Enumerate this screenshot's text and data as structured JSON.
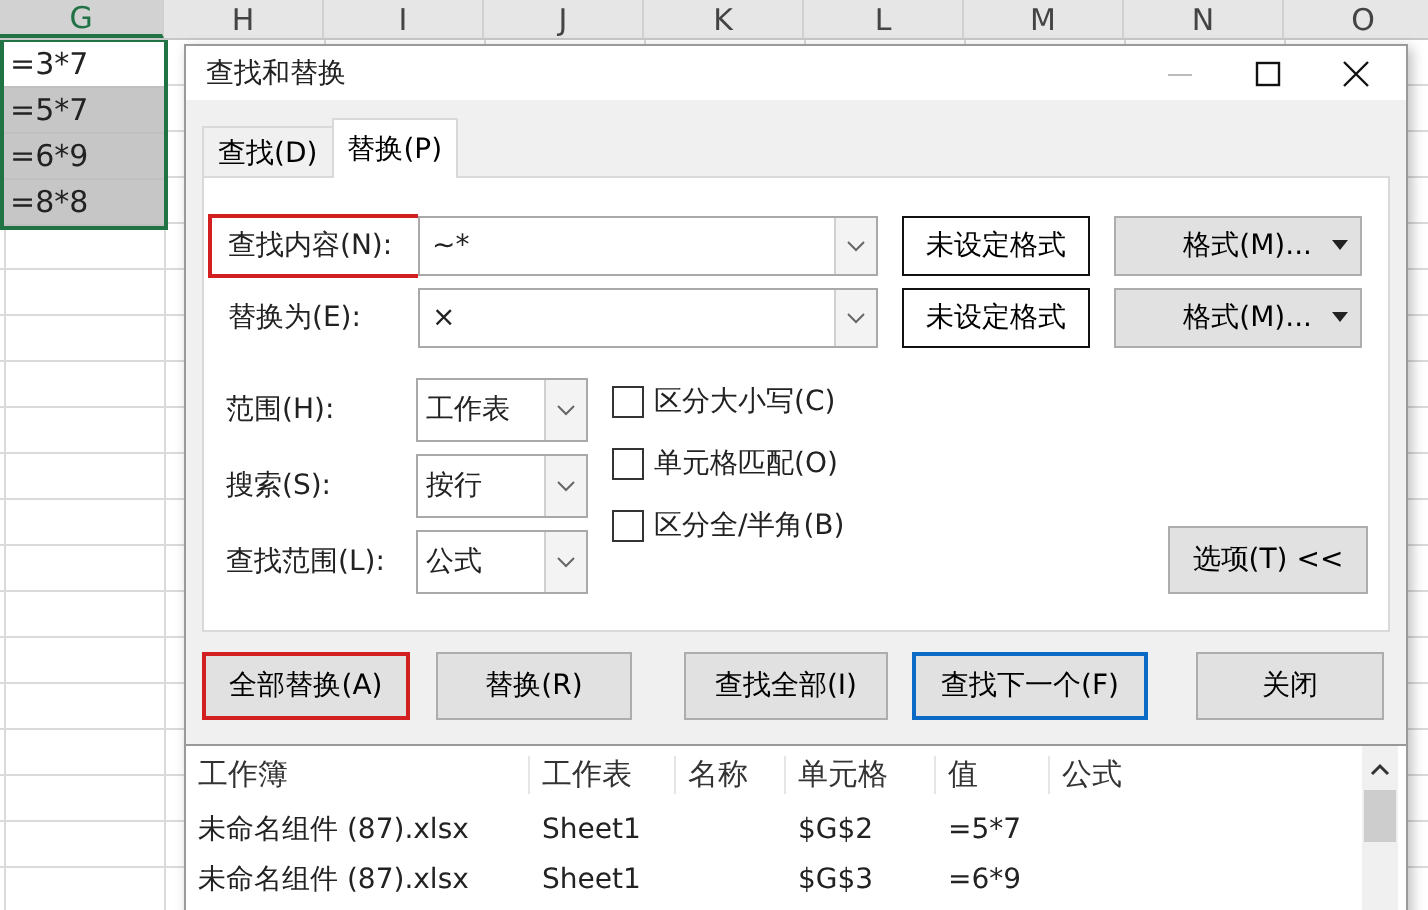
{
  "sheet": {
    "columns": [
      {
        "label": "G",
        "selected": true
      },
      {
        "label": "H",
        "selected": false
      },
      {
        "label": "I",
        "selected": false
      },
      {
        "label": "J",
        "selected": false
      },
      {
        "label": "K",
        "selected": false
      },
      {
        "label": "L",
        "selected": false
      },
      {
        "label": "M",
        "selected": false
      },
      {
        "label": "N",
        "selected": false
      },
      {
        "label": "O",
        "selected": false
      }
    ],
    "cells": [
      {
        "value": "=3*7",
        "selected": false
      },
      {
        "value": "=5*7",
        "selected": true
      },
      {
        "value": "=6*9",
        "selected": true
      },
      {
        "value": "=8*8",
        "selected": true
      }
    ]
  },
  "dialog": {
    "title": "查找和替换",
    "tabs": [
      {
        "label": "查找(D)",
        "selected": false
      },
      {
        "label": "替换(P)",
        "selected": true
      }
    ],
    "fields": [
      {
        "label": "查找内容(N):",
        "value": "~*",
        "highlighted": true,
        "format_status": "未设定格式",
        "format_menu": "格式(M)..."
      },
      {
        "label": "替换为(E):",
        "value": "×",
        "highlighted": false,
        "format_status": "未设定格式",
        "format_menu": "格式(M)..."
      }
    ],
    "selects": [
      {
        "label": "范围(H):",
        "value": "工作表"
      },
      {
        "label": "搜索(S):",
        "value": "按行"
      },
      {
        "label": "查找范围(L):",
        "value": "公式"
      }
    ],
    "checkboxes": [
      {
        "label": "区分大小写(C)",
        "checked": false
      },
      {
        "label": "单元格匹配(O)",
        "checked": false
      },
      {
        "label": "区分全/半角(B)",
        "checked": false
      }
    ],
    "options_button": "选项(T) <<",
    "buttons": [
      {
        "label": "全部替换(A)",
        "highlighted": true,
        "default": false
      },
      {
        "label": "替换(R)",
        "highlighted": false,
        "default": false
      },
      {
        "label": "查找全部(I)",
        "highlighted": false,
        "default": false
      },
      {
        "label": "查找下一个(F)",
        "highlighted": false,
        "default": true
      },
      {
        "label": "关闭",
        "highlighted": false,
        "default": false
      }
    ],
    "results": {
      "columns": [
        "工作簿",
        "工作表",
        "名称",
        "单元格",
        "值",
        "公式"
      ],
      "rows": [
        [
          "未命名组件 (87).xlsx",
          "Sheet1",
          "",
          "$G$2",
          "=5*7",
          ""
        ],
        [
          "未命名组件 (87).xlsx",
          "Sheet1",
          "",
          "$G$3",
          "=6*9",
          ""
        ]
      ]
    }
  }
}
